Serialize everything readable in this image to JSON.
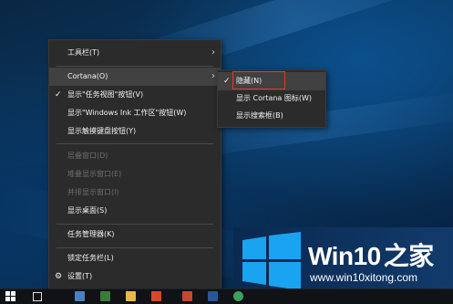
{
  "context_menu": {
    "items": [
      {
        "label": "工具栏(T)",
        "has_submenu": true,
        "checked": false,
        "disabled": false
      },
      {
        "label": "Cortana(O)",
        "has_submenu": true,
        "checked": false,
        "disabled": false,
        "highlighted": true
      },
      {
        "label": "显示\"任务视图\"按钮(V)",
        "has_submenu": false,
        "checked": true,
        "disabled": false
      },
      {
        "label": "显示\"Windows Ink 工作区\"按钮(W)",
        "has_submenu": false,
        "checked": false,
        "disabled": false
      },
      {
        "label": "显示触摸键盘按钮(Y)",
        "has_submenu": false,
        "checked": false,
        "disabled": false
      },
      {
        "label": "层叠窗口(D)",
        "has_submenu": false,
        "checked": false,
        "disabled": true
      },
      {
        "label": "堆叠显示窗口(E)",
        "has_submenu": false,
        "checked": false,
        "disabled": true
      },
      {
        "label": "并排显示窗口(I)",
        "has_submenu": false,
        "checked": false,
        "disabled": true
      },
      {
        "label": "显示桌面(S)",
        "has_submenu": false,
        "checked": false,
        "disabled": false
      },
      {
        "label": "任务管理器(K)",
        "has_submenu": false,
        "checked": false,
        "disabled": false
      },
      {
        "label": "锁定任务栏(L)",
        "has_submenu": false,
        "checked": false,
        "disabled": false
      },
      {
        "label": "设置(T)",
        "has_submenu": false,
        "checked": false,
        "disabled": false,
        "icon": "gear-icon"
      }
    ],
    "check_glyph": "✓",
    "arrow_glyph": "›",
    "gear_glyph": "⚙"
  },
  "cortana_submenu": {
    "items": [
      {
        "label": "隐藏(N)",
        "checked": true,
        "highlighted": true
      },
      {
        "label": "显示 Cortana 图标(W)",
        "checked": false
      },
      {
        "label": "显示搜索框(B)",
        "checked": false
      }
    ]
  },
  "watermark": {
    "title_part1": "Win10",
    "title_part2": "之家",
    "url": "www.win10xitong.com"
  },
  "colors": {
    "menu_bg": "#2b2b2b",
    "menu_hover": "#414141",
    "highlight_border": "#e23a2b",
    "win_logo": "#1aa3f0"
  }
}
